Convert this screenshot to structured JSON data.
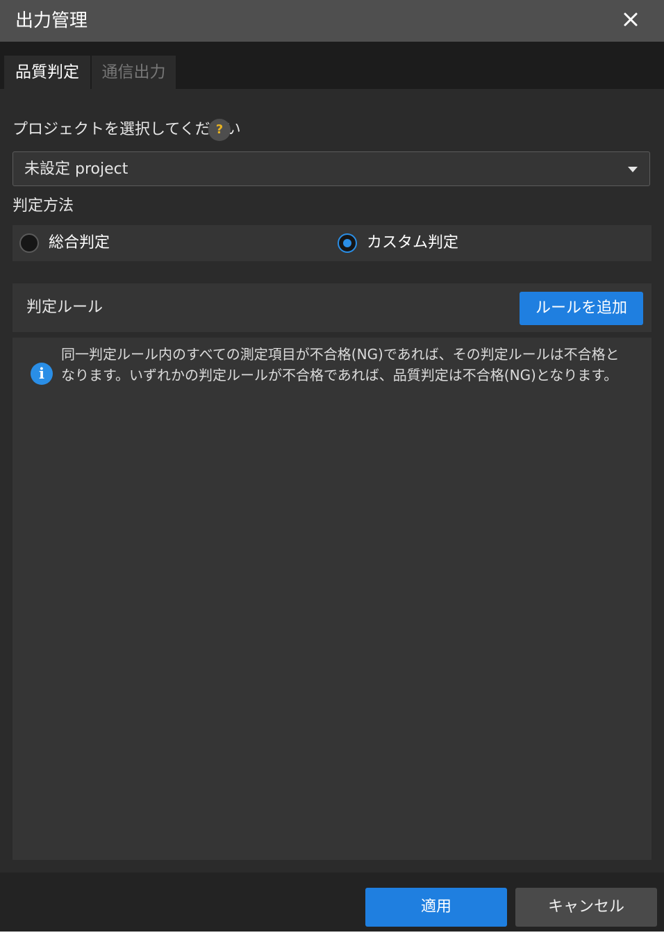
{
  "window": {
    "title": "出力管理",
    "close_icon": "close-icon"
  },
  "tabs": [
    {
      "label": "品質判定",
      "active": true
    },
    {
      "label": "通信出力",
      "active": false
    }
  ],
  "project": {
    "label": "プロジェクトを選択してください",
    "help_glyph": "?",
    "selected": "未設定  project"
  },
  "method": {
    "label": "判定方法",
    "options": [
      {
        "label": "総合判定",
        "selected": false
      },
      {
        "label": "カスタム判定",
        "selected": true
      }
    ]
  },
  "rules": {
    "title": "判定ルール",
    "add_label": "ルールを追加",
    "info_glyph": "i",
    "info_text": "同一判定ルール内のすべての測定項目が不合格(NG)であれば、その判定ルールは不合格となります。いずれかの判定ルールが不合格であれば、品質判定は不合格(NG)となります。"
  },
  "footer": {
    "apply_label": "適用",
    "cancel_label": "キャンセル"
  },
  "colors": {
    "accent": "#1f7fe0",
    "background": "#2b2b2b",
    "panel": "#353535",
    "titlebar": "#4f4f4f",
    "help": "#e8b321"
  }
}
